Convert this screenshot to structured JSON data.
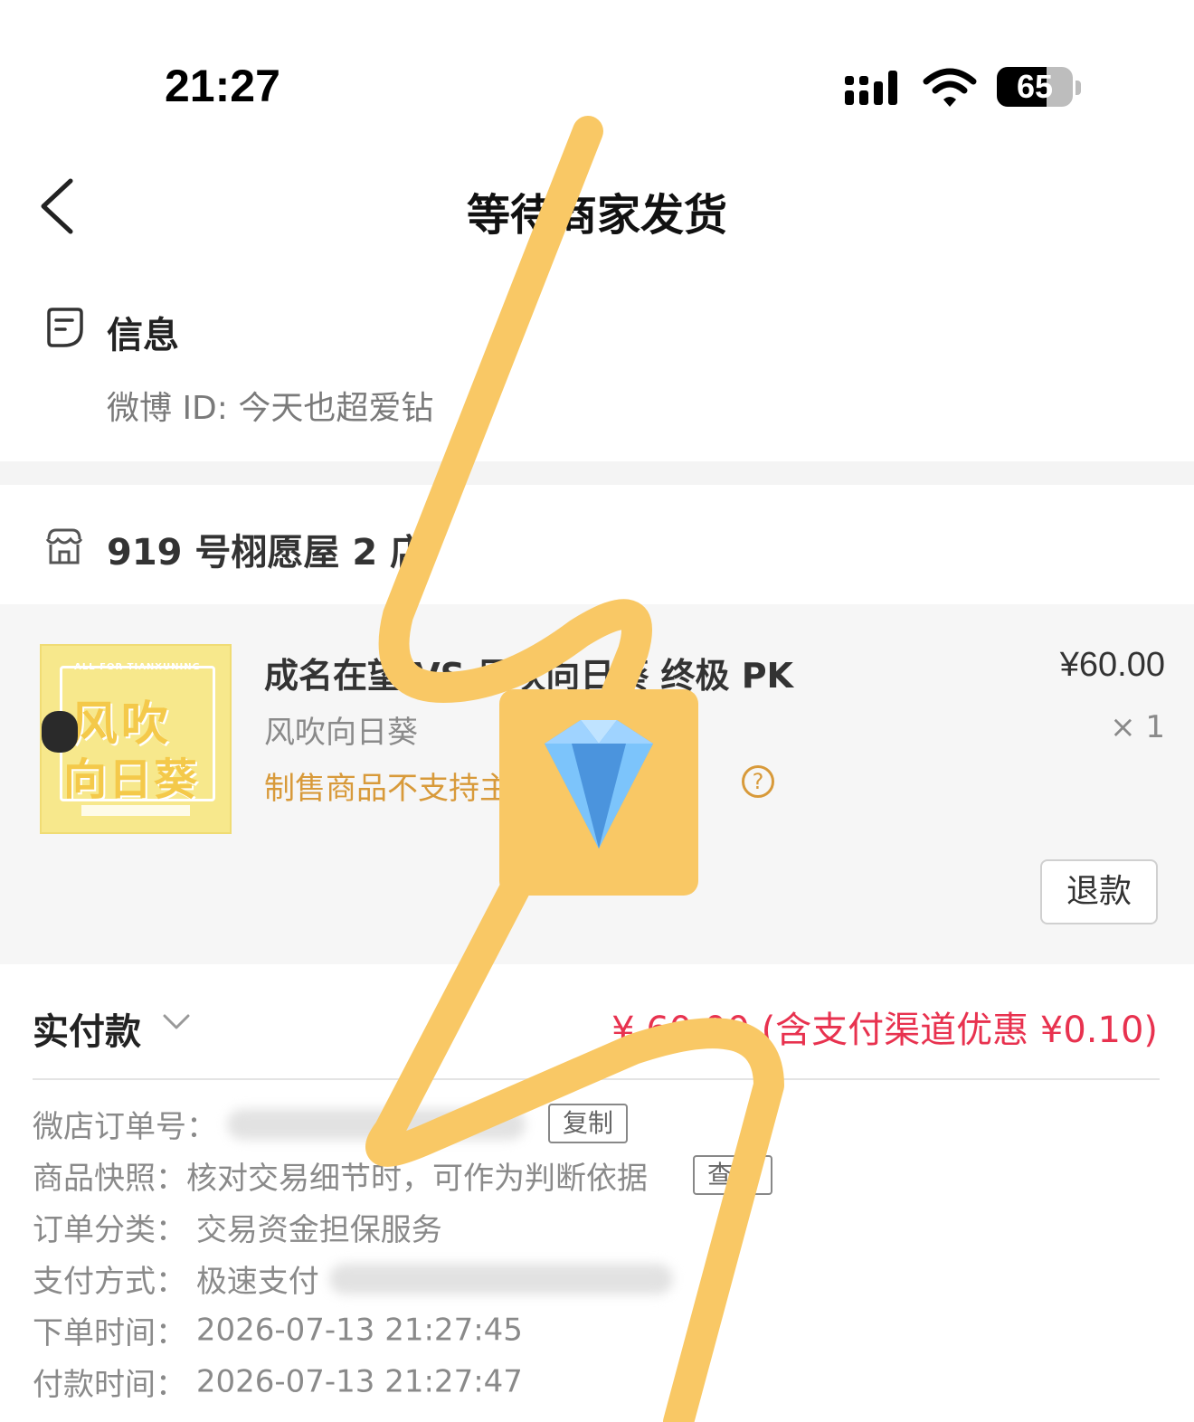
{
  "status_bar": {
    "time": "21:27",
    "battery_level": "65",
    "battery_fraction": 0.65,
    "icons": [
      "cellular-signal-icon",
      "wifi-icon",
      "battery-icon"
    ]
  },
  "nav": {
    "back_icon": "back-chevron-icon",
    "title": "等待商家发货"
  },
  "info": {
    "icon": "message-icon",
    "title": "信息",
    "weibo_id_line": "微博 ID: 今天也超爱钻"
  },
  "store": {
    "icon": "store-icon",
    "name": "919 号栩愿屋 2 店"
  },
  "product": {
    "thumbnail_caption": "ALL FOR TIANXUNING",
    "thumbnail_text_1": "风吹",
    "thumbnail_text_2": "向日葵",
    "title": "成名在望 VS 风吹向日葵 终极 PK",
    "price": "¥60.00",
    "variant": "风吹向日葵",
    "quantity": "× 1",
    "notice": "制售商品不支持主动退款",
    "help_icon": "?",
    "refund_button": "退款"
  },
  "payment": {
    "label": "实付款",
    "amount": "¥ 60.00 (含支付渠道优惠 ¥0.10)"
  },
  "details": {
    "order_no_label": "微店订单号：",
    "copy_button": "复制",
    "snapshot_label": "商品快照：核对交易细节时，可作为判断依据",
    "view_button": "查看",
    "category_label": "订单分类：",
    "category_value": "交易资金担保服务",
    "pay_method_label": "支付方式：",
    "pay_method_value": "极速支付",
    "order_time_label": "下单时间：",
    "order_time_value": "2026-07-13 21:27:45",
    "pay_time_label": "付款时间：",
    "pay_time_value": "2026-07-13 21:27:47"
  },
  "overlay": {
    "scribble_color": "#f9c865",
    "emoji": "💎"
  },
  "colors": {
    "accent_red": "#e8324f",
    "notice_orange": "#d89a3a"
  }
}
